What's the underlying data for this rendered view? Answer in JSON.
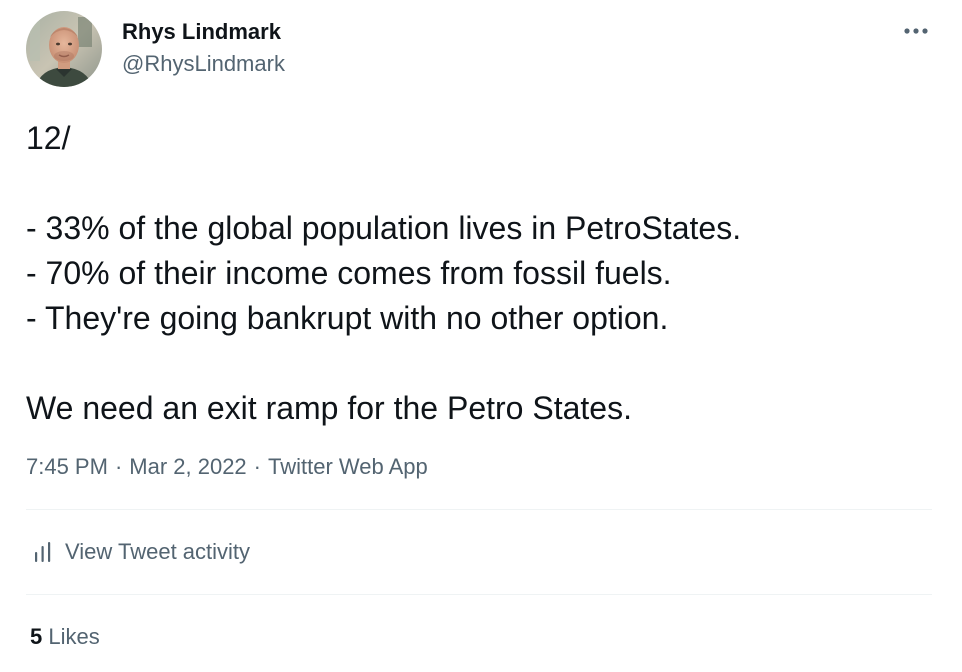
{
  "author": {
    "display_name": "Rhys Lindmark",
    "handle": "@RhysLindmark"
  },
  "tweet": {
    "lines": [
      "12/",
      "",
      "- 33% of the global population lives in PetroStates.",
      "- 70% of their income comes from fossil fuels.",
      "- They're going bankrupt with no other option.",
      "",
      "We need an exit ramp for the Petro States."
    ]
  },
  "meta": {
    "time": "7:45 PM",
    "separator": "·",
    "date": "Mar 2, 2022",
    "source": "Twitter Web App"
  },
  "activity": {
    "label": "View Tweet activity",
    "icon": "analytics-icon"
  },
  "likes": {
    "count": "5",
    "label": "Likes"
  },
  "icons": {
    "more": "more-options-icon"
  },
  "colors": {
    "text_primary": "#0f1419",
    "text_secondary": "#536471",
    "divider": "#eff3f4"
  }
}
